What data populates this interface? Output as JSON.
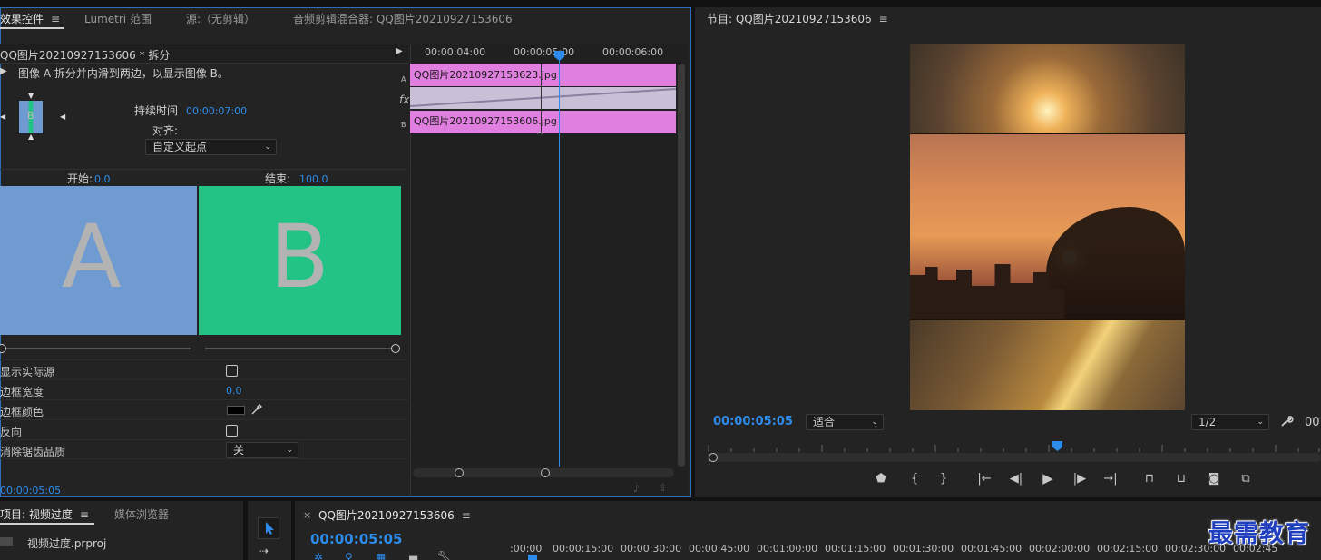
{
  "effect_controls_panel": {
    "tabs": [
      {
        "label": "效果控件",
        "active": true
      },
      {
        "label": "Lumetri 范围",
        "active": false
      },
      {
        "label": "源:（无剪辑）",
        "active": false
      },
      {
        "label": "音频剪辑混合器: QQ图片20210927153606",
        "active": false
      }
    ],
    "clip_title": "QQ图片20210927153606 * 拆分",
    "description": "图像 A 拆分并内滑到两边，以显示图像 B。",
    "duration_label": "持续时间",
    "duration_value": "00:00:07:00",
    "align_label": "对齐:",
    "align_value": "自定义起点",
    "start_label": "开始:",
    "start_value": "0.0",
    "end_label": "结束:",
    "end_value": "100.0",
    "preview_a": "A",
    "preview_b": "B",
    "properties": [
      {
        "label": "显示实际源",
        "type": "checkbox",
        "value": ""
      },
      {
        "label": "边框宽度",
        "type": "number",
        "value": "0.0"
      },
      {
        "label": "边框颜色",
        "type": "color",
        "value": "#000000"
      },
      {
        "label": "反向",
        "type": "checkbox",
        "value": ""
      },
      {
        "label": "消除锯齿品质",
        "type": "select",
        "value": "关"
      }
    ],
    "current_time": "00:00:05:05",
    "mini_timeline": {
      "ticks": [
        "00:00:04:00",
        "00:00:05:00",
        "00:00:06:00"
      ],
      "track_a_label": "A",
      "track_fx_label": "fx",
      "track_b_label": "B",
      "clip_a": "QQ图片20210927153623.jpg",
      "clip_b": "QQ图片20210927153606.jpg"
    }
  },
  "program_monitor": {
    "title": "节目: QQ图片20210927153606",
    "timecode": "00:00:05:05",
    "fit_value": "适合",
    "resolution_value": "1/2",
    "right_timecode_partial": "00:"
  },
  "project_panel": {
    "tabs": [
      {
        "label": "项目: 视频过度",
        "active": true
      },
      {
        "label": "媒体浏览器",
        "active": false
      }
    ],
    "file_name": "视频过度.prproj"
  },
  "timeline_panel": {
    "sequence_name": "QQ图片20210927153606",
    "timecode": "00:00:05:05",
    "ruler_ticks": [
      ":00:00",
      "00:00:15:00",
      "00:00:30:00",
      "00:00:45:00",
      "00:01:00:00",
      "00:01:15:00",
      "00:01:30:00",
      "00:01:45:00",
      "00:02:00:00",
      "00:02:15:00",
      "00:02:30:00",
      "00:02:45"
    ]
  },
  "watermark": "最需教育",
  "colors": {
    "accent_blue": "#2d8ceb",
    "clip_pink": "#e07fdf",
    "preview_a_blue": "#6f9bd1",
    "preview_b_green": "#23c285",
    "watermark_blue": "#1f3fbf"
  }
}
